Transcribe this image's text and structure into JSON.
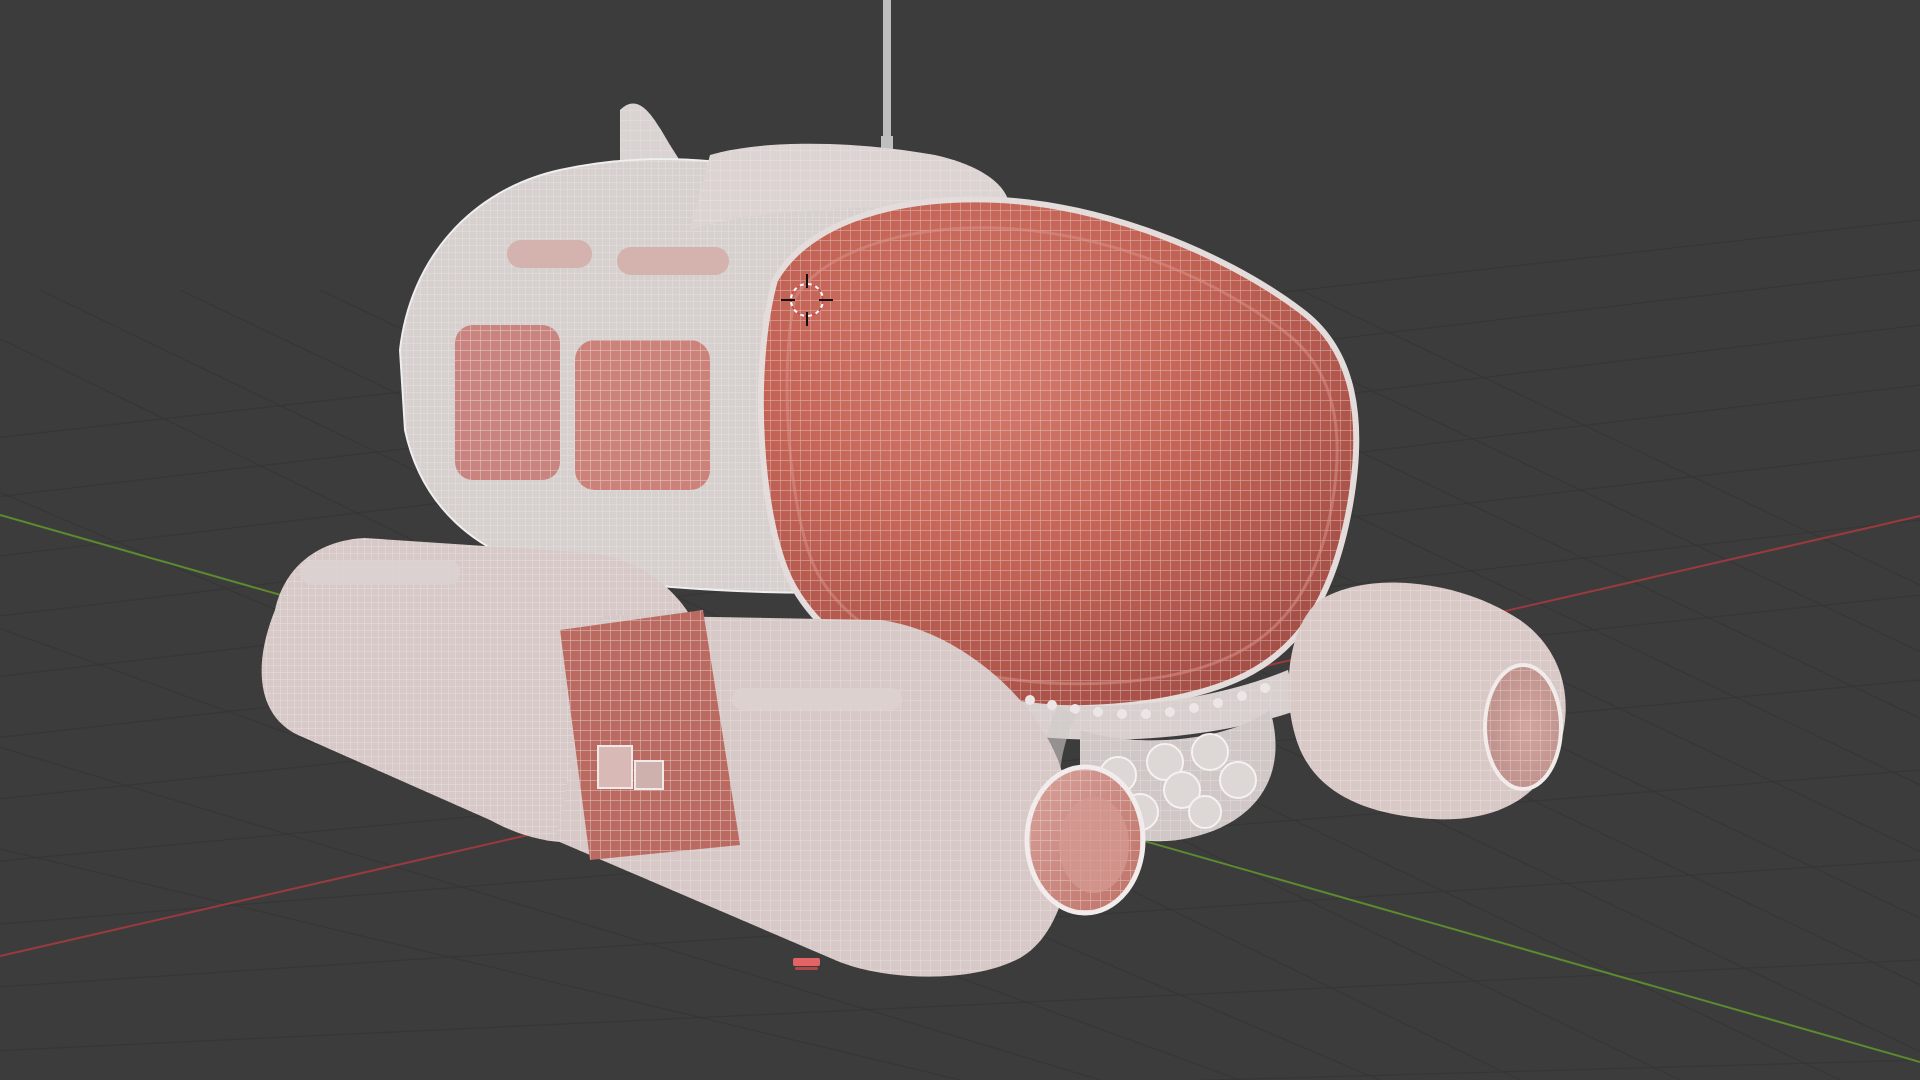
{
  "viewport": {
    "background_color": "#3c3c3c",
    "grid_color": "#333333",
    "x_axis_color": "#a4373e",
    "y_axis_color": "#5d8d2f",
    "mesh_base_color": "#c96b5f",
    "mesh_wire_color": "#e6dcda",
    "mesh_edge_color": "#d8d3d2",
    "antenna_color": "#bfbfbf"
  },
  "scene": {
    "object_name": "submarine-mesh",
    "shading": "wireframe-overlay",
    "cursor_icon": "3d-cursor-icon",
    "light_icon": "light-icon"
  }
}
